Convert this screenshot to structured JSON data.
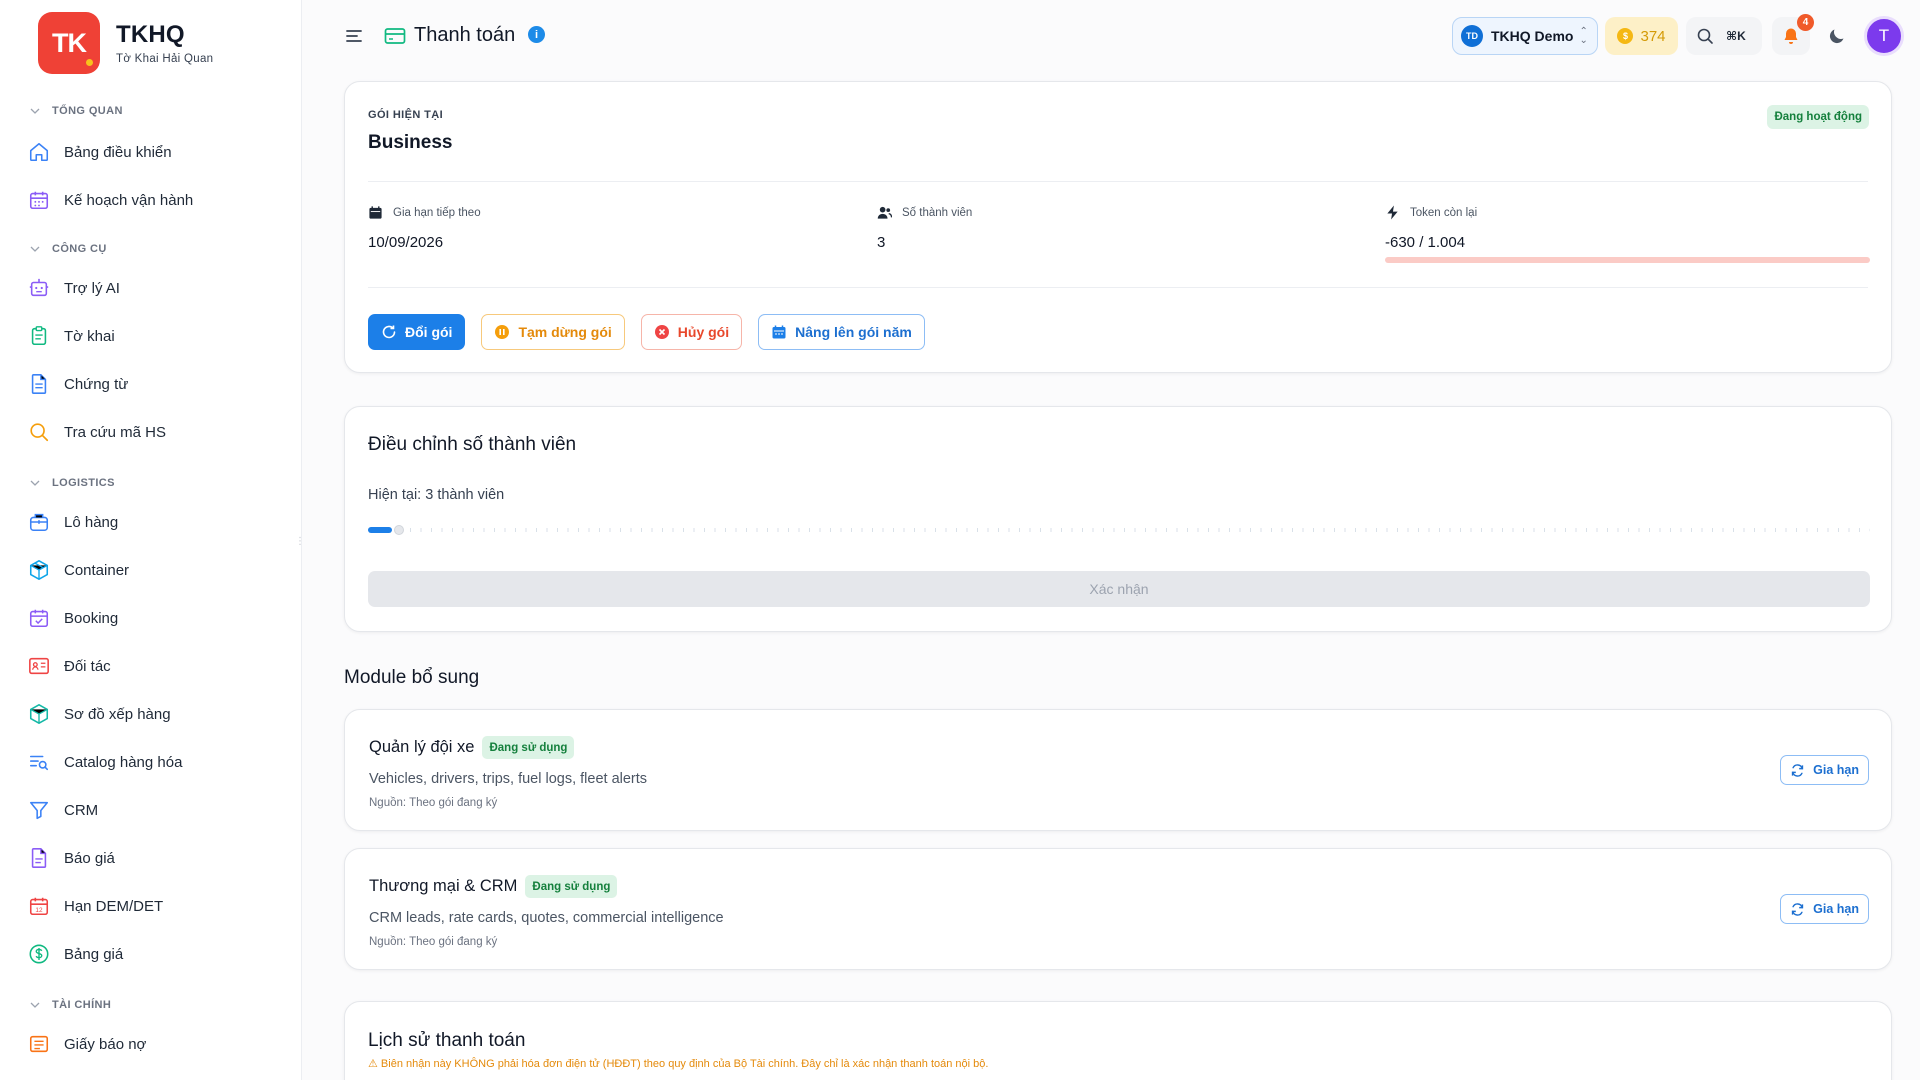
{
  "brand": {
    "logo_text": "TK",
    "name": "TKHQ",
    "subtitle": "Tờ Khai Hải Quan"
  },
  "sidebar": {
    "sections": [
      {
        "label": "TỔNG QUAN"
      },
      {
        "label": "CÔNG CỤ"
      },
      {
        "label": "LOGISTICS"
      },
      {
        "label": "TÀI CHÍNH"
      }
    ],
    "items": [
      {
        "label": "Bảng điều khiển",
        "icon": "home-icon"
      },
      {
        "label": "Kế hoạch vận hành",
        "icon": "calendar-grid-icon"
      },
      {
        "label": "Trợ lý AI",
        "icon": "bot-icon"
      },
      {
        "label": "Tờ khai",
        "icon": "clipboard-icon"
      },
      {
        "label": "Chứng từ",
        "icon": "document-icon"
      },
      {
        "label": "Tra cứu mã HS",
        "icon": "search-icon"
      },
      {
        "label": "Lô hàng",
        "icon": "package-box-icon"
      },
      {
        "label": "Container",
        "icon": "cube-icon"
      },
      {
        "label": "Booking",
        "icon": "calendar-check-icon"
      },
      {
        "label": "Đối tác",
        "icon": "contact-card-icon"
      },
      {
        "label": "Sơ đồ xếp hàng",
        "icon": "cube-3d-icon"
      },
      {
        "label": "Catalog hàng hóa",
        "icon": "list-search-icon"
      },
      {
        "label": "CRM",
        "icon": "filter-icon"
      },
      {
        "label": "Báo giá",
        "icon": "file-text-icon"
      },
      {
        "label": "Hạn DEM/DET",
        "icon": "calendar-date-icon"
      },
      {
        "label": "Bảng giá",
        "icon": "dollar-circle-icon"
      },
      {
        "label": "Giấy báo nợ",
        "icon": "receipt-icon"
      }
    ]
  },
  "header": {
    "title": "Thanh toán",
    "info_icon": "i",
    "org": {
      "initials": "TD",
      "name": "TKHQ Demo"
    },
    "coins": "374",
    "shortcut": "⌘K",
    "notifications": "4",
    "user_initial": "T"
  },
  "plan": {
    "eyebrow": "GÓI HIỆN TẠI",
    "name": "Business",
    "status": "Đang hoạt động",
    "stats": [
      {
        "label": "Gia hạn tiếp theo",
        "value": "10/09/2026",
        "icon": "calendar-icon"
      },
      {
        "label": "Số thành viên",
        "value": "3",
        "icon": "users-icon"
      },
      {
        "label": "Token còn lại",
        "value": "-630 / 1.004",
        "icon": "lightning-icon"
      }
    ],
    "token_usage_fraction": 0,
    "buttons": {
      "change": "Đổi gói",
      "pause": "Tạm dừng gói",
      "cancel": "Hủy gói",
      "upgrade": "Nâng lên gói năm"
    }
  },
  "members": {
    "title": "Điều chỉnh số thành viên",
    "current": "Hiện tại: 3 thành viên",
    "slider_fraction": 0.016,
    "confirm": "Xác nhận"
  },
  "modules": {
    "heading": "Module bổ sung",
    "items": [
      {
        "title": "Quản lý đội xe",
        "badge": "Đang sử dụng",
        "description": "Vehicles, drivers, trips, fuel logs, fleet alerts",
        "source": "Nguồn: Theo gói đang ký",
        "action": "Gia hạn"
      },
      {
        "title": "Thương mại & CRM",
        "badge": "Đang sử dụng",
        "description": "CRM leads, rate cards, quotes, commercial intelligence",
        "source": "Nguồn: Theo gói đang ký",
        "action": "Gia hạn"
      }
    ]
  },
  "history": {
    "title": "Lịch sử thanh toán",
    "note": "⚠ Biên nhận này KHÔNG phải hóa đơn điện tử (HĐĐT) theo quy định của Bộ Tài chính. Đây chỉ là xác nhận thanh toán nội bộ."
  },
  "colors": {
    "brand_red": "#ef4136",
    "primary_blue": "#1c7fe8",
    "success_green": "#15803d",
    "warning_orange": "#e48a0b",
    "danger_red": "#e8482c"
  }
}
